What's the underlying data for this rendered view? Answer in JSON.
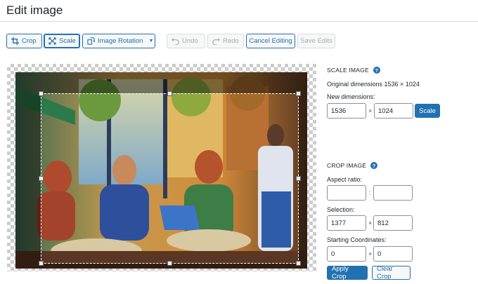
{
  "page": {
    "title": "Edit image"
  },
  "toolbar": {
    "crop": "Crop",
    "scale": "Scale",
    "rotation": "Image Rotation",
    "undo": "Undo",
    "redo": "Redo",
    "cancel": "Cancel Editing",
    "save": "Save Edits"
  },
  "scale": {
    "heading": "SCALE IMAGE",
    "original": "Original dimensions 1536 × 1024",
    "new_label": "New dimensions:",
    "width": "1536",
    "height": "1024",
    "sep": "×",
    "button": "Scale"
  },
  "crop": {
    "heading": "CROP IMAGE",
    "aspect_label": "Aspect ratio:",
    "aspect_w": "",
    "aspect_h": "",
    "aspect_sep": ":",
    "selection_label": "Selection:",
    "sel_w": "1377",
    "sel_h": "812",
    "sel_sep": "×",
    "start_label": "Starting Coordinates:",
    "start_x": "0",
    "start_y": "0",
    "start_sep": "×",
    "apply": "Apply Crop",
    "clear": "Clear Crop"
  },
  "icons": {
    "crop": "crop-icon",
    "scale": "scale-icon",
    "rotation": "rotate-icon",
    "undo": "undo-icon",
    "redo": "redo-icon",
    "help": "help-icon"
  },
  "colors": {
    "accent": "#2271b1",
    "disabled": "#a7aaad"
  }
}
